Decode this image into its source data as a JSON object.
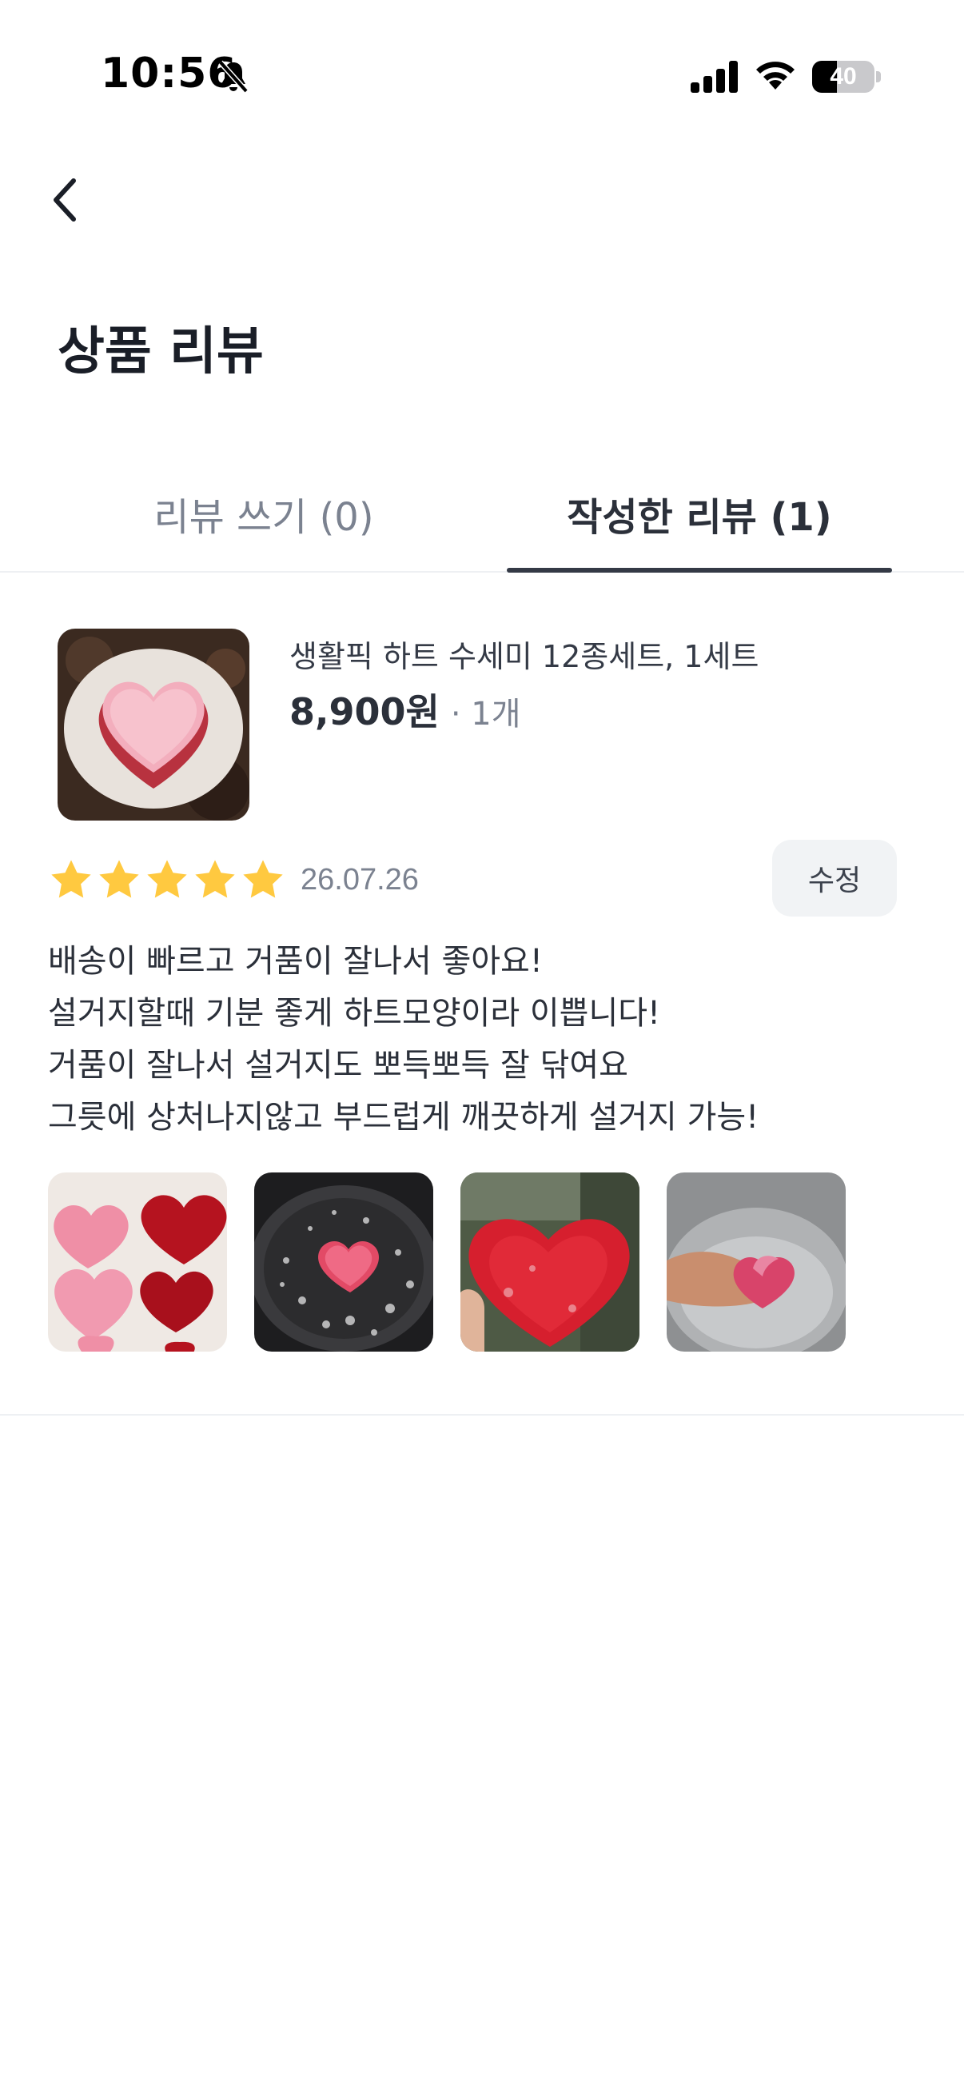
{
  "status_bar": {
    "time": "10:56",
    "battery_level": "40",
    "battery_fraction": 0.4,
    "icons": [
      "bell-off-icon",
      "signal-icon",
      "wifi-icon",
      "battery-icon"
    ]
  },
  "header": {
    "back_icon": "chevron-left-icon",
    "title": "상품 리뷰"
  },
  "tabs": [
    {
      "label": "리뷰 쓰기 (0)",
      "active": false
    },
    {
      "label": "작성한 리뷰 (1)",
      "active": true
    }
  ],
  "review": {
    "product": {
      "name": "생활픽 하트 수세미 12종세트, 1세트",
      "price": "8,900원",
      "quantity": "· 1개"
    },
    "rating": 5,
    "rating_max": 5,
    "date": "26.07.26",
    "edit_label": "수정",
    "text_lines": [
      "배송이 빠르고 거품이 잘나서 좋아요!",
      "설거지할때 기분 좋게 하트모양이라 이쁩니다!",
      "거품이 잘나서 설거지도 뽀득뽀득 잘 닦여요",
      "그릇에 상처나지않고 부드럽게 깨끗하게 설거지 가능!"
    ],
    "photo_count": 4
  },
  "colors": {
    "star": "#FFC940",
    "active_tab_indicator": "#343A46",
    "edit_button_bg": "#F1F3F5",
    "muted_text": "#7B8290"
  }
}
